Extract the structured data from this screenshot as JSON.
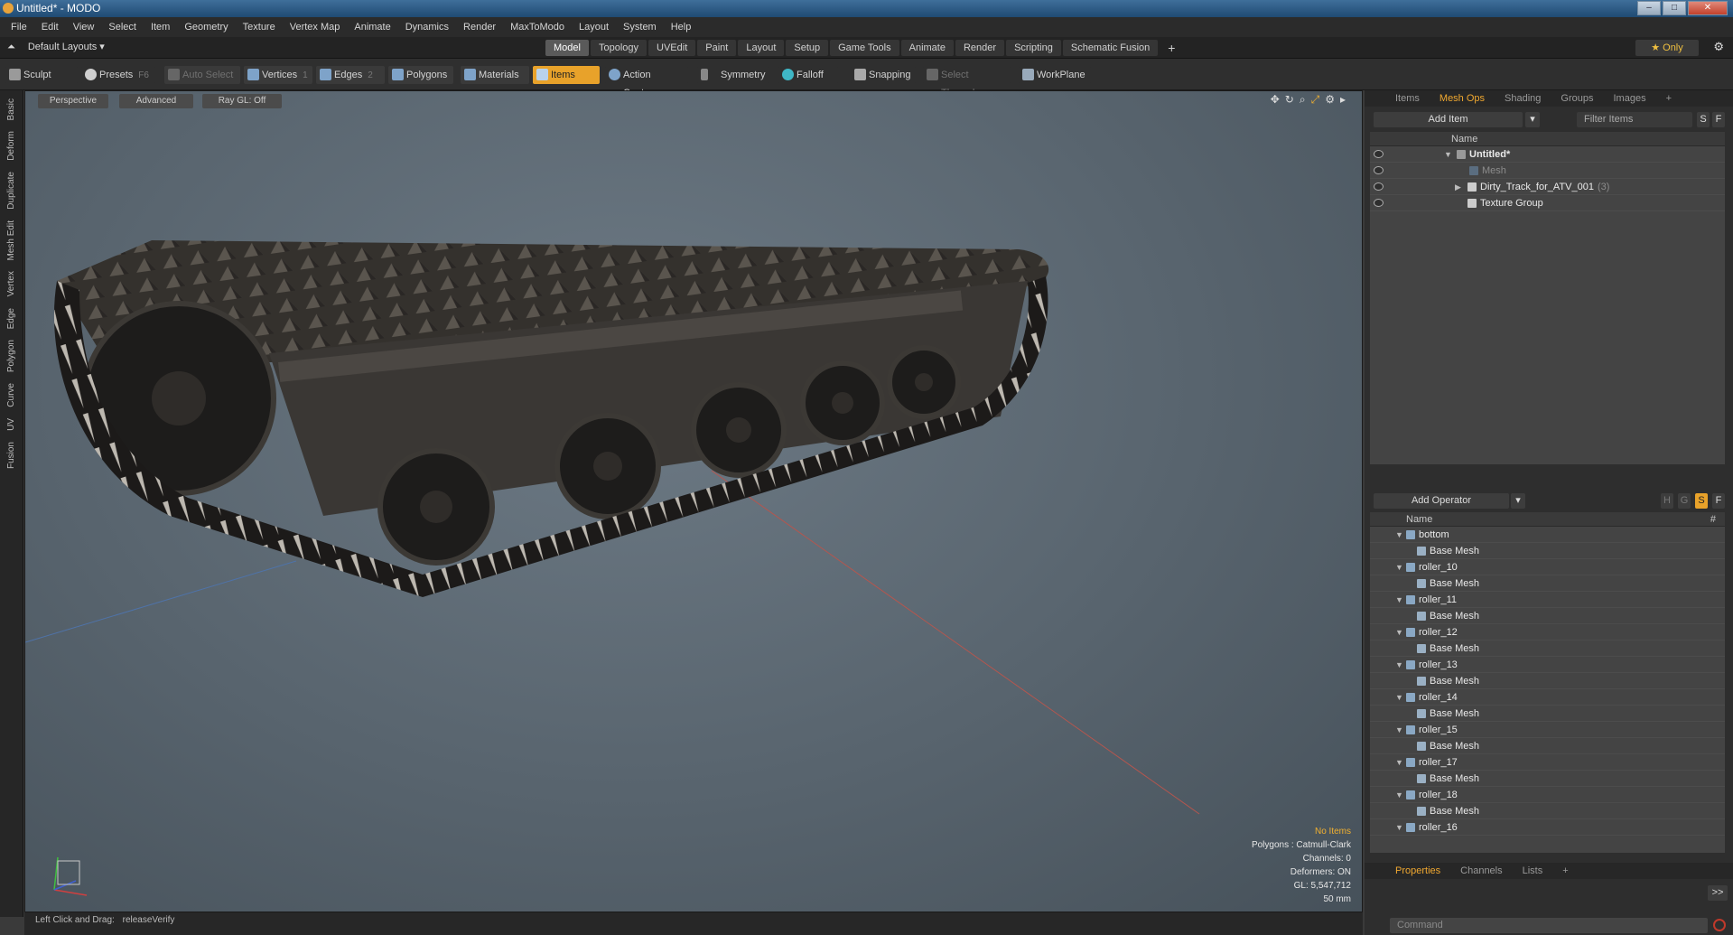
{
  "window": {
    "title": "Untitled* - MODO"
  },
  "menu": [
    "File",
    "Edit",
    "View",
    "Select",
    "Item",
    "Geometry",
    "Texture",
    "Vertex Map",
    "Animate",
    "Dynamics",
    "Render",
    "MaxToModo",
    "Layout",
    "System",
    "Help"
  ],
  "layout_bar": {
    "layout_select": "Default Layouts ▾",
    "tabs": [
      "Model",
      "Topology",
      "UVEdit",
      "Paint",
      "Layout",
      "Setup",
      "Game Tools",
      "Animate",
      "Render",
      "Scripting",
      "Schematic Fusion"
    ],
    "active_tab": "Model",
    "add_tab": "+",
    "only_label": "★ Only"
  },
  "toolbar": {
    "sculpt": "Sculpt",
    "presets": "Presets",
    "presets_key": "F6",
    "auto_select": "Auto Select",
    "vertices": "Vertices",
    "vertices_key": "1",
    "edges": "Edges",
    "edges_key": "2",
    "polygons": "Polygons",
    "materials": "Materials",
    "items": "Items",
    "action_center": "Action Center",
    "symmetry": "Symmetry",
    "falloff": "Falloff",
    "snapping": "Snapping",
    "select_through": "Select Through",
    "workplane": "WorkPlane"
  },
  "left_tabs": [
    "Basic",
    "Deform",
    "Duplicate",
    "Mesh Edit",
    "Vertex",
    "Edge",
    "Polygon",
    "Curve",
    "UV",
    "Fusion"
  ],
  "viewport": {
    "view_mode": "Perspective",
    "shading": "Advanced",
    "raygl": "Ray GL: Off",
    "stats": {
      "selection": "No Items",
      "polygons": "Polygons : Catmull-Clark",
      "channels": "Channels: 0",
      "deformers": "Deformers: ON",
      "gl": "GL: 5,547,712",
      "focal": "50 mm"
    }
  },
  "status": {
    "hint": "Left Click and Drag:",
    "action": "releaseVerify"
  },
  "items_panel": {
    "tabs": [
      "Items",
      "Mesh Ops",
      "Shading",
      "Groups",
      "Images",
      "+"
    ],
    "active_tab": "Mesh Ops",
    "add_item": "Add Item",
    "filter": "Filter Items",
    "filter_s": "S",
    "filter_f": "F",
    "col_name": "Name",
    "rows": [
      {
        "label": "Untitled*",
        "bold": true
      },
      {
        "label": "Mesh",
        "dim": true
      },
      {
        "label": "Dirty_Track_for_ATV_001",
        "count": "(3)"
      },
      {
        "label": "Texture Group"
      }
    ]
  },
  "ops_panel": {
    "add_operator": "Add Operator",
    "col_name": "Name",
    "col_hash": "#",
    "flags": [
      "H",
      "G",
      "S",
      "F"
    ],
    "rows": [
      {
        "label": "bottom",
        "child": "Base Mesh"
      },
      {
        "label": "roller_10",
        "child": "Base Mesh"
      },
      {
        "label": "roller_11",
        "child": "Base Mesh"
      },
      {
        "label": "roller_12",
        "child": "Base Mesh"
      },
      {
        "label": "roller_13",
        "child": "Base Mesh"
      },
      {
        "label": "roller_14",
        "child": "Base Mesh"
      },
      {
        "label": "roller_15",
        "child": "Base Mesh"
      },
      {
        "label": "roller_17",
        "child": "Base Mesh"
      },
      {
        "label": "roller_18",
        "child": "Base Mesh"
      },
      {
        "label": "roller_16",
        "child": ""
      }
    ]
  },
  "props_panel": {
    "tabs": [
      "Properties",
      "Channels",
      "Lists",
      "+"
    ],
    "active_tab": "Properties",
    "expand": ">>",
    "command_placeholder": "Command"
  },
  "colors": {
    "accent": "#e8a22a",
    "viewport_bg": "#5d6973",
    "panel_bg": "#2e2e2e"
  }
}
